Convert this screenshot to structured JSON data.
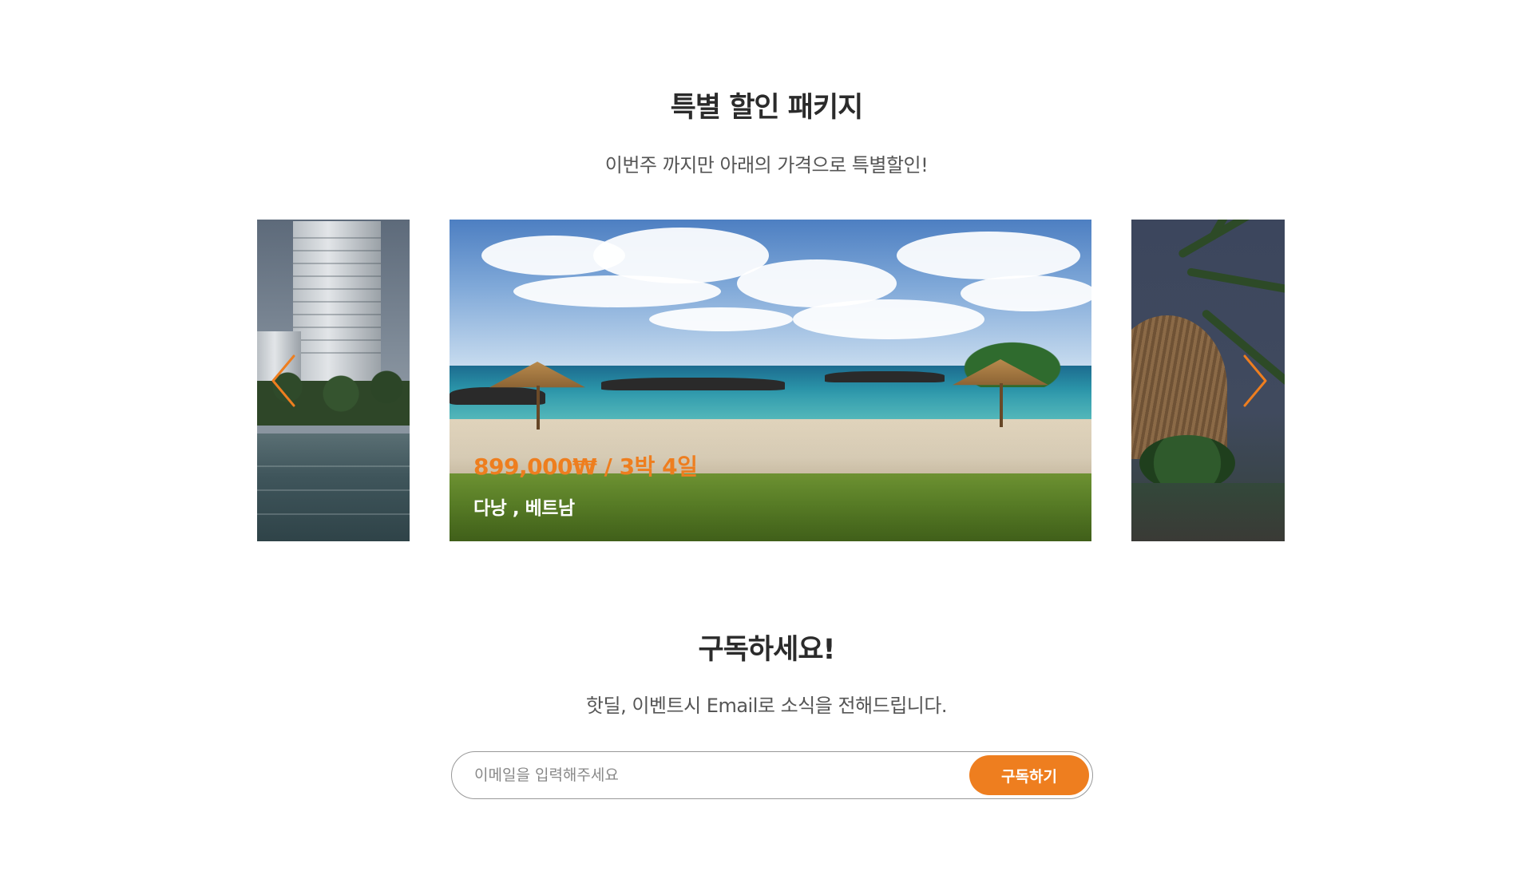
{
  "packages": {
    "title": "특별 할인 패키지",
    "subtitle": "이번주 까지만 아래의 가격으로 특별할인!",
    "carousel": {
      "prev_icon": "chevron-left-icon",
      "next_icon": "chevron-right-icon",
      "arrow_color": "#ee7e1f",
      "active_slide": {
        "price": "899,000₩ / 3박 4일",
        "destination": "다낭 , 베트남"
      }
    }
  },
  "subscribe": {
    "title": "구독하세요!",
    "description": "핫딜, 이벤트시 Email로 소식을 전해드립니다.",
    "email_value": "",
    "email_placeholder": "이메일을 입력해주세요",
    "button_label": "구독하기"
  },
  "colors": {
    "accent": "#ee7e1f",
    "heading": "#2b2b2b",
    "body_text": "#555555"
  }
}
